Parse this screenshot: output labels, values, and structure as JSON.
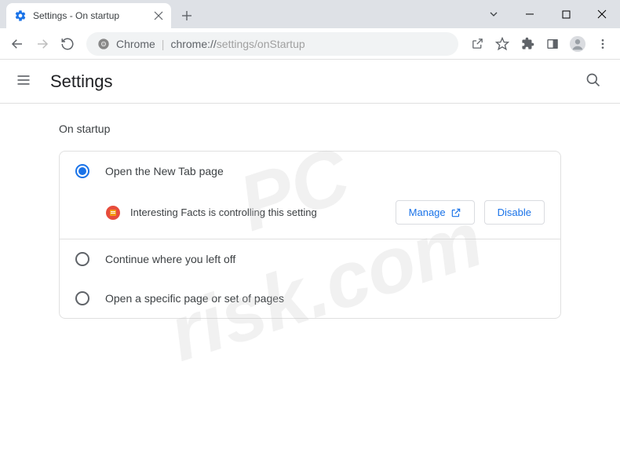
{
  "window": {
    "tab_title": "Settings - On startup"
  },
  "omnibox": {
    "scheme_label": "Chrome",
    "url_host": "chrome://",
    "url_path": "settings/onStartup"
  },
  "page": {
    "title": "Settings",
    "section_title": "On startup"
  },
  "startup": {
    "options": [
      {
        "label": "Open the New Tab page",
        "selected": true
      },
      {
        "label": "Continue where you left off",
        "selected": false
      },
      {
        "label": "Open a specific page or set of pages",
        "selected": false
      }
    ],
    "extension_notice": "Interesting Facts is controlling this setting",
    "manage_button": "Manage",
    "disable_button": "Disable"
  },
  "watermark": {
    "line1": "PC",
    "line2": "risk.com"
  }
}
